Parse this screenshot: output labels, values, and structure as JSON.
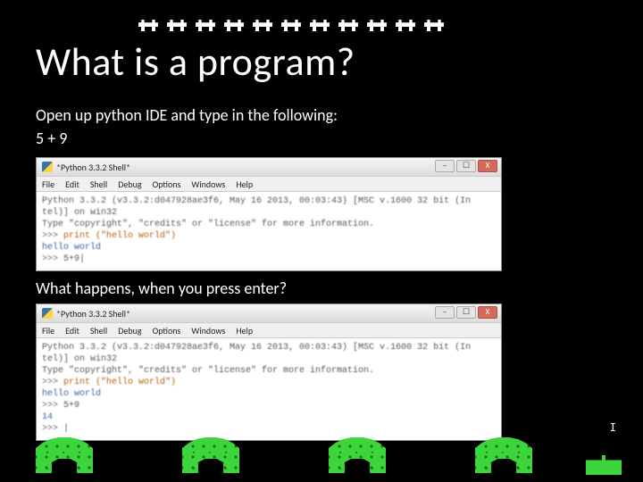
{
  "title": "What is a program?",
  "instruction": "Open up python IDE and type in the following:",
  "expression": "5 + 9",
  "question2": "What happens, when you press enter?",
  "idle": {
    "window_title": "*Python 3.3.2 Shell*",
    "menus": [
      "File",
      "Edit",
      "Shell",
      "Debug",
      "Options",
      "Windows",
      "Help"
    ],
    "banner1": "Python 3.3.2 (v3.3.2:d047928ae3f6, May 16 2013, 00:03:43) [MSC v.1600 32 bit (In",
    "banner2": "tel)] on win32",
    "banner3": "Type \"copyright\", \"credits\" or \"license\" for more information.",
    "prompt": ">>>",
    "line_print": "print (\"hello world\")",
    "line_out_hello": "hello world",
    "line_expr": "5+9",
    "line_result": "14",
    "cursor": "|"
  },
  "win_btns": {
    "min": "–",
    "max": "☐",
    "close": "X"
  },
  "score_indicator": "I"
}
